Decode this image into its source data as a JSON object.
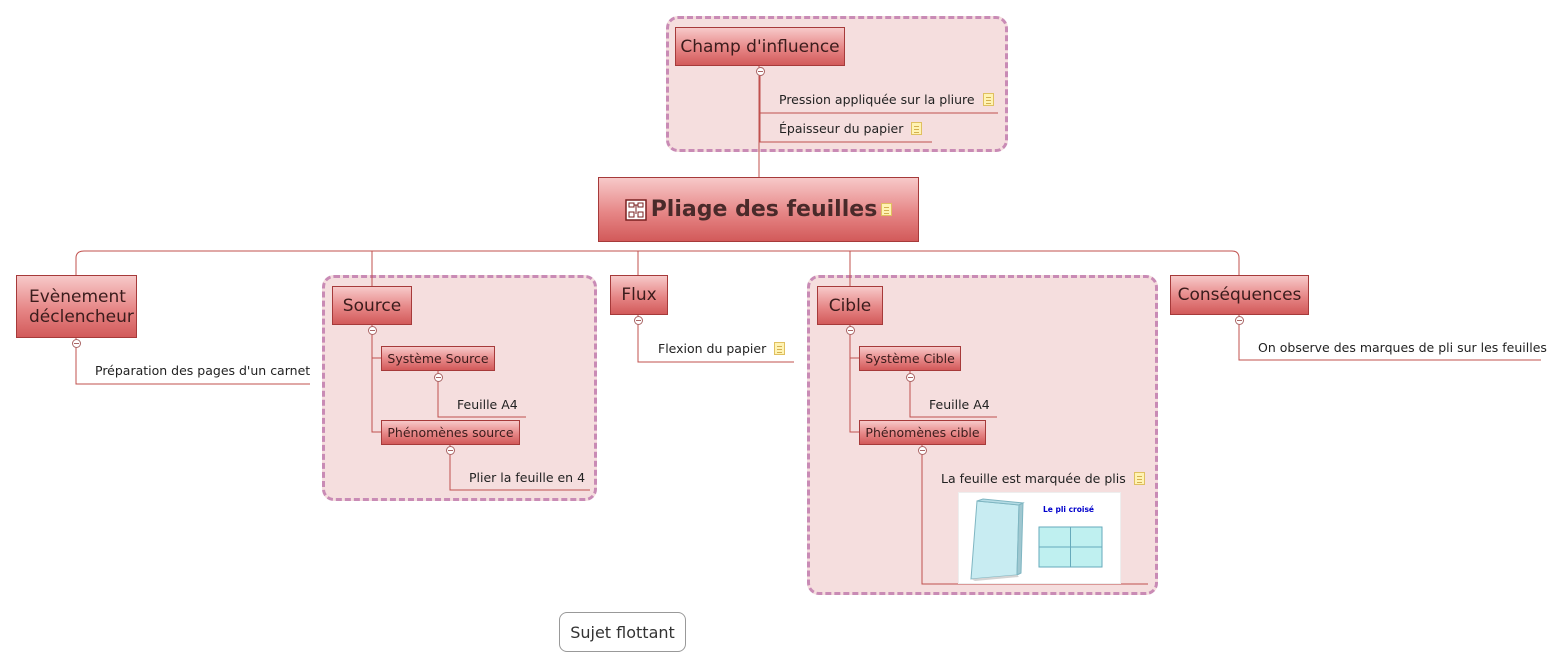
{
  "central": {
    "label": "Pliage des feuilles"
  },
  "top": {
    "label": "Champ d'influence",
    "items": [
      "Pression appliquée sur la pliure",
      "Épaisseur du papier"
    ]
  },
  "branches": {
    "evenement": {
      "label": "Evènement déclencheur",
      "leaf": "Préparation des pages d'un carnet"
    },
    "source": {
      "label": "Source",
      "systeme": {
        "label": "Système Source",
        "leaf": "Feuille A4"
      },
      "phenomenes": {
        "label": "Phénomènes source",
        "leaf": "Plier la feuille en 4"
      }
    },
    "flux": {
      "label": "Flux",
      "leaf": "Flexion du papier"
    },
    "cible": {
      "label": "Cible",
      "systeme": {
        "label": "Système Cible",
        "leaf": "Feuille A4"
      },
      "phenomenes": {
        "label": "Phénomènes cible",
        "leaf": "La feuille est marquée de plis"
      },
      "image_caption": "Le pli croisé"
    },
    "consequences": {
      "label": "Conséquences",
      "leaf": "On observe des marques de pli sur les feuilles"
    }
  },
  "floating": {
    "label": "Sujet flottant"
  },
  "colors": {
    "line": "#c0504d",
    "group_bg": "#f5dede",
    "group_border": "#c98bb5"
  }
}
